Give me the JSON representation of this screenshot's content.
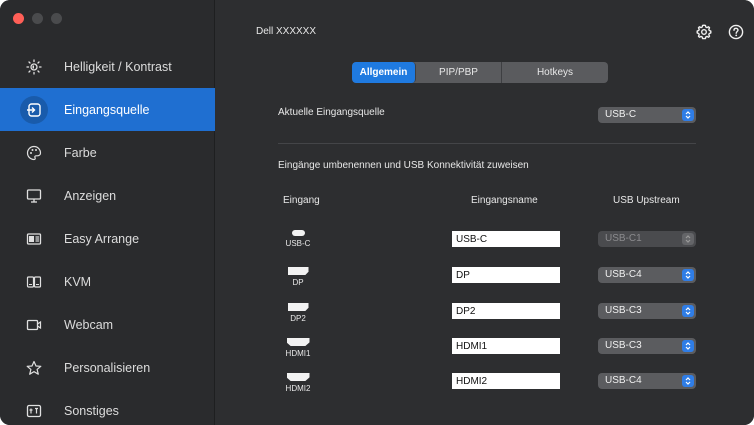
{
  "app": {
    "model": "Dell XXXXXX"
  },
  "colors": {
    "accent": "#1f6fd1",
    "tab_active": "#1f7ae0",
    "window_red": "#ff5f57"
  },
  "sidebar": {
    "items": [
      {
        "label": "Helligkeit / Kontrast",
        "icon": "brightness-icon",
        "active": false
      },
      {
        "label": "Eingangsquelle",
        "icon": "input-source-icon",
        "active": true
      },
      {
        "label": "Farbe",
        "icon": "color-palette-icon",
        "active": false
      },
      {
        "label": "Anzeigen",
        "icon": "monitor-icon",
        "active": false
      },
      {
        "label": "Easy Arrange",
        "icon": "easy-arrange-icon",
        "active": false
      },
      {
        "label": "KVM",
        "icon": "kvm-icon",
        "active": false
      },
      {
        "label": "Webcam",
        "icon": "webcam-icon",
        "active": false
      },
      {
        "label": "Personalisieren",
        "icon": "star-icon",
        "active": false
      },
      {
        "label": "Sonstiges",
        "icon": "misc-icon",
        "active": false
      }
    ]
  },
  "header": {
    "icons": [
      "settings-gear-icon",
      "help-icon"
    ]
  },
  "tabs": [
    {
      "label": "Allgemein",
      "active": true
    },
    {
      "label": "PIP/PBP",
      "active": false
    },
    {
      "label": "Hotkeys",
      "active": false
    }
  ],
  "current_source": {
    "label": "Aktuelle Eingangsquelle",
    "value": "USB-C"
  },
  "rename": {
    "title": "Eingänge umbenennen und USB Konnektivität zuweisen",
    "col_input": "Eingang",
    "col_name": "Eingangsname",
    "col_usb": "USB Upstream",
    "rows": [
      {
        "port": "USB-C",
        "port_icon": "usb-c-port-icon",
        "name": "USB-C",
        "usb": "USB-C1",
        "usb_disabled": true
      },
      {
        "port": "DP",
        "port_icon": "displayport-icon",
        "name": "DP",
        "usb": "USB-C4",
        "usb_disabled": false
      },
      {
        "port": "DP2",
        "port_icon": "displayport-icon",
        "name": "DP2",
        "usb": "USB-C3",
        "usb_disabled": false
      },
      {
        "port": "HDMI1",
        "port_icon": "hdmi-port-icon",
        "name": "HDMI1",
        "usb": "USB-C3",
        "usb_disabled": false
      },
      {
        "port": "HDMI2",
        "port_icon": "hdmi-port-icon",
        "name": "HDMI2",
        "usb": "USB-C4",
        "usb_disabled": false
      }
    ]
  }
}
